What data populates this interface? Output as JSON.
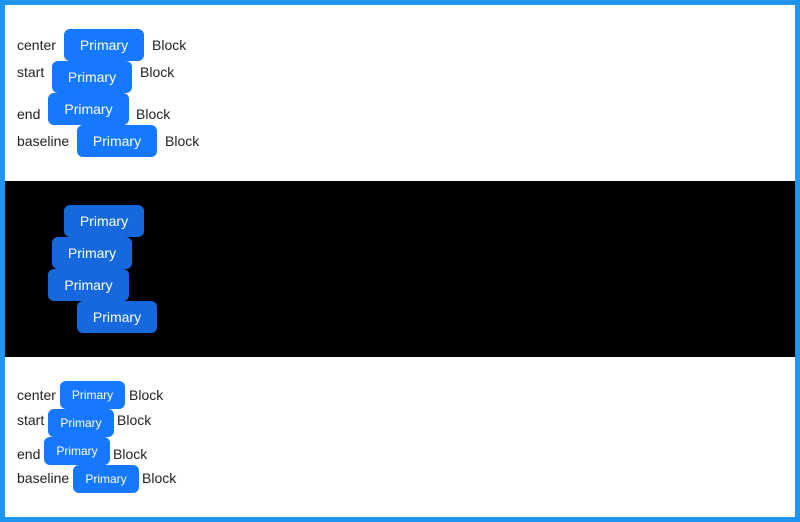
{
  "colors": {
    "frame": "#1f95f0",
    "primary": "#1677ff",
    "primary_dark": "#1668dc",
    "band": "#000000"
  },
  "section1": {
    "rows": [
      {
        "label": "center",
        "button": "Primary",
        "suffix": "Block"
      },
      {
        "label": "start",
        "button": "Primary",
        "suffix": "Block"
      },
      {
        "label": "end",
        "button": "Primary",
        "suffix": "Block"
      },
      {
        "label": "baseline",
        "button": "Primary",
        "suffix": "Block"
      }
    ]
  },
  "section2": {
    "buttons": [
      "Primary",
      "Primary",
      "Primary",
      "Primary"
    ]
  },
  "section3": {
    "rows": [
      {
        "label": "center",
        "button": "Primary",
        "suffix": "Block"
      },
      {
        "label": "start",
        "button": "Primary",
        "suffix": "Block"
      },
      {
        "label": "end",
        "button": "Primary",
        "suffix": "Block"
      },
      {
        "label": "baseline",
        "button": "Primary",
        "suffix": "Block"
      }
    ]
  }
}
